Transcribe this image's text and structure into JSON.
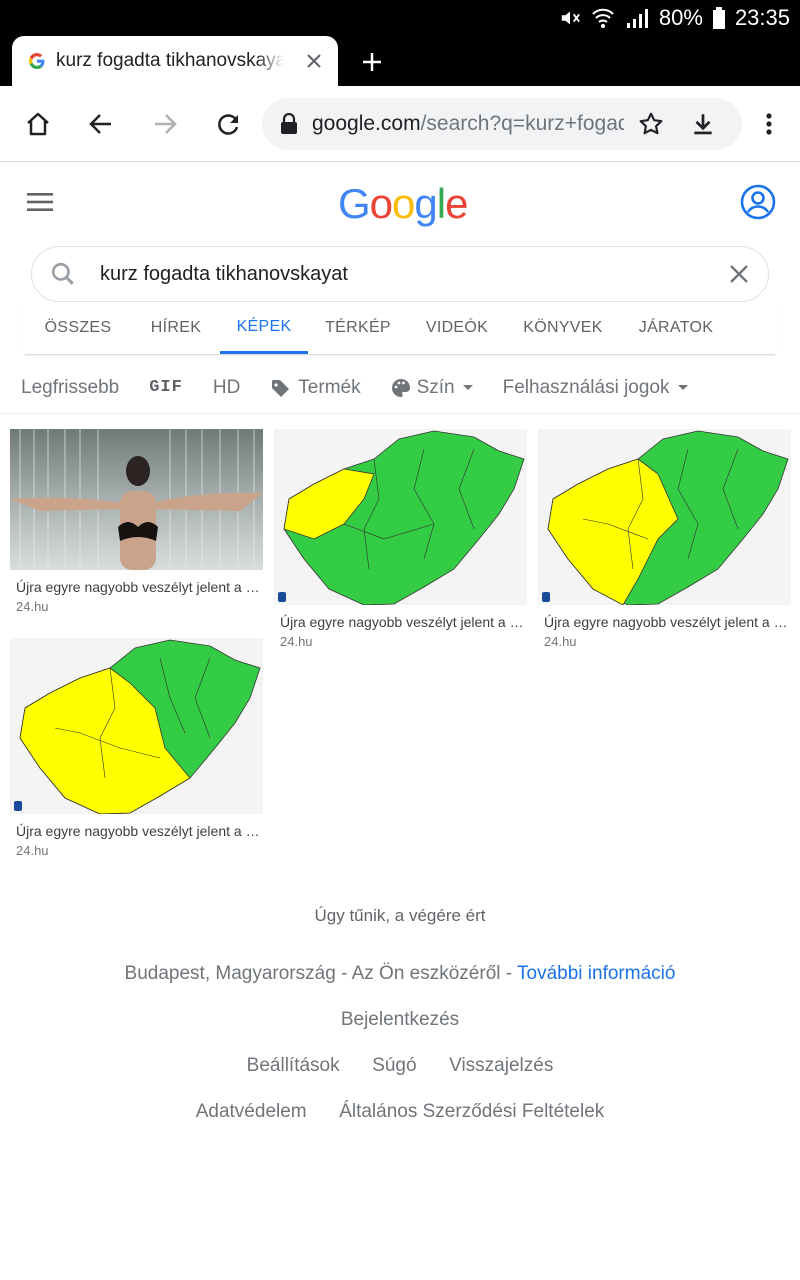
{
  "status": {
    "battery": "80%",
    "time": "23:35"
  },
  "browser": {
    "tab_title": "kurz fogadta tikhanovskayat - Google",
    "url_host": "google.com",
    "url_path": "/search?q=kurz+fogadta+tikhanovskayat"
  },
  "google": {
    "logo": [
      "G",
      "o",
      "o",
      "g",
      "l",
      "e"
    ],
    "logo_colors": [
      "#4285F4",
      "#EA4335",
      "#FBBC05",
      "#4285F4",
      "#34A853",
      "#EA4335"
    ],
    "query": "kurz fogadta tikhanovskayat"
  },
  "tabs": [
    "ÖSSZES",
    "HÍREK",
    "KÉPEK",
    "TÉRKÉP",
    "VIDEÓK",
    "KÖNYVEK",
    "JÁRATOK"
  ],
  "active_tab": "KÉPEK",
  "filters": {
    "latest": "Legfrissebb",
    "gif": "GIF",
    "hd": "HD",
    "product": "Termék",
    "color": "Szín",
    "rights": "Felhasználási jogok"
  },
  "results": [
    {
      "caption": "Újra egyre nagyobb veszélyt jelent a hőség",
      "source": "24.hu"
    },
    {
      "caption": "Újra egyre nagyobb veszélyt jelent a hőség",
      "source": "24.hu"
    },
    {
      "caption": "Újra egyre nagyobb veszélyt jelent a hőség",
      "source": "24.hu"
    },
    {
      "caption": "Újra egyre nagyobb veszélyt jelent a hőség",
      "source": "24.hu"
    }
  ],
  "footer": {
    "end_text": "Úgy tűnik, a végére ért",
    "location": "Budapest, Magyarország - Az Ön eszközéről - ",
    "more_info": "További információ",
    "signin": "Bejelentkezés",
    "settings": "Beállítások",
    "help": "Súgó",
    "feedback": "Visszajelzés",
    "privacy": "Adatvédelem",
    "terms": "Általános Szerződési Feltételek"
  }
}
